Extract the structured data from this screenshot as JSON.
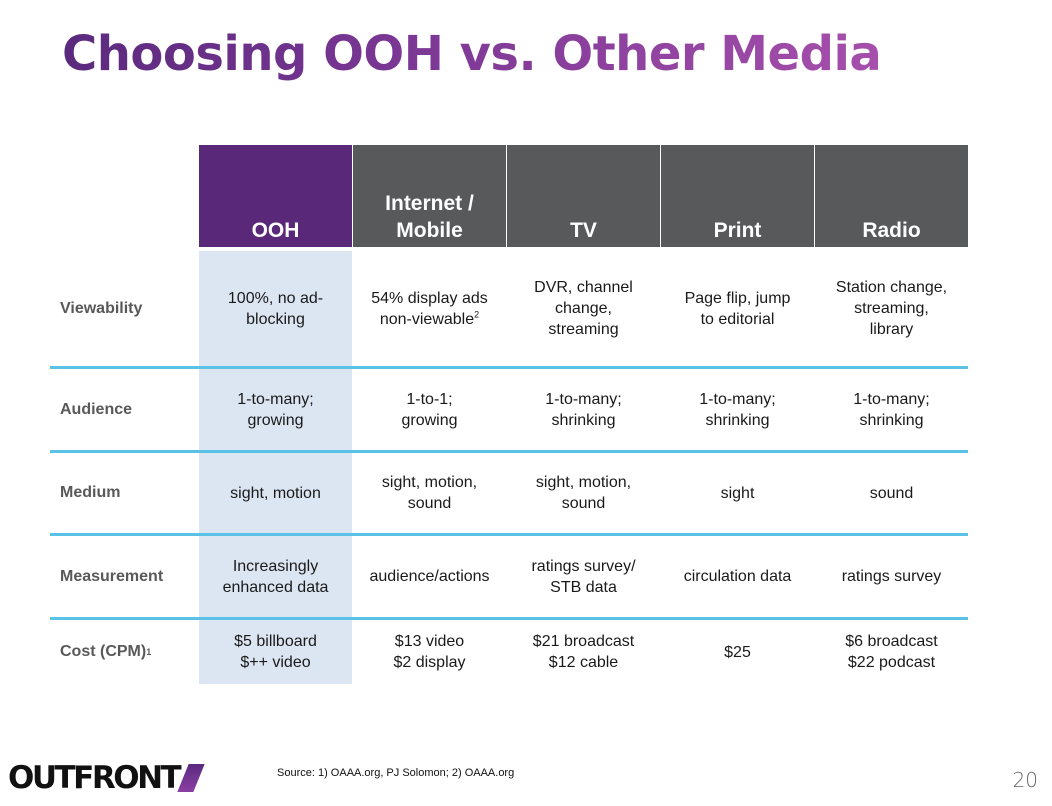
{
  "slide": {
    "title": "Choosing OOH vs. Other Media",
    "page_number": "20",
    "source": "Source: 1) OAAA.org, PJ Solomon; 2) OAAA.org",
    "logo": "OUTFRONT",
    "colors": {
      "ooh_header": "#5a2878",
      "other_header": "#58595b",
      "ooh_column_bg": "#dce6f2",
      "separator": "#5bc2e7",
      "title_start": "#5a2a7e",
      "title_end": "#a64fac"
    }
  },
  "table": {
    "headers": [
      {
        "line1": "",
        "line2": "OOH"
      },
      {
        "line1": "Internet /",
        "line2": "Mobile"
      },
      {
        "line1": "",
        "line2": "TV"
      },
      {
        "line1": "",
        "line2": "Print"
      },
      {
        "line1": "",
        "line2": "Radio"
      }
    ],
    "rows": [
      {
        "label": "Viewability",
        "label_sup": "",
        "cells": [
          {
            "lines": [
              "100%, no ad-",
              "blocking"
            ],
            "sup": ""
          },
          {
            "lines": [
              "54% display ads",
              "non-viewable"
            ],
            "sup": "2"
          },
          {
            "lines": [
              "DVR, channel",
              "change,",
              "streaming"
            ],
            "sup": ""
          },
          {
            "lines": [
              "Page flip, jump",
              "to editorial"
            ],
            "sup": ""
          },
          {
            "lines": [
              "Station change,",
              "streaming,",
              "library"
            ],
            "sup": ""
          }
        ]
      },
      {
        "label": "Audience",
        "label_sup": "",
        "cells": [
          {
            "lines": [
              "1-to-many;",
              "growing"
            ],
            "sup": ""
          },
          {
            "lines": [
              "1-to-1;",
              "growing"
            ],
            "sup": ""
          },
          {
            "lines": [
              "1-to-many;",
              "shrinking"
            ],
            "sup": ""
          },
          {
            "lines": [
              "1-to-many;",
              "shrinking"
            ],
            "sup": ""
          },
          {
            "lines": [
              "1-to-many;",
              "shrinking"
            ],
            "sup": ""
          }
        ]
      },
      {
        "label": "Medium",
        "label_sup": "",
        "cells": [
          {
            "lines": [
              "sight, motion"
            ],
            "sup": ""
          },
          {
            "lines": [
              "sight, motion,",
              "sound"
            ],
            "sup": ""
          },
          {
            "lines": [
              "sight, motion,",
              "sound"
            ],
            "sup": ""
          },
          {
            "lines": [
              "sight"
            ],
            "sup": ""
          },
          {
            "lines": [
              "sound"
            ],
            "sup": ""
          }
        ]
      },
      {
        "label": "Measurement",
        "label_sup": "",
        "cells": [
          {
            "lines": [
              "Increasingly",
              "enhanced data"
            ],
            "sup": ""
          },
          {
            "lines": [
              "audience/actions"
            ],
            "sup": ""
          },
          {
            "lines": [
              "ratings survey/",
              "STB data"
            ],
            "sup": ""
          },
          {
            "lines": [
              "circulation data"
            ],
            "sup": ""
          },
          {
            "lines": [
              "ratings survey"
            ],
            "sup": ""
          }
        ]
      },
      {
        "label": "Cost (CPM)",
        "label_sup": "1",
        "cells": [
          {
            "lines": [
              "$5 billboard",
              "$++ video"
            ],
            "sup": ""
          },
          {
            "lines": [
              "$13 video",
              "$2 display"
            ],
            "sup": ""
          },
          {
            "lines": [
              "$21 broadcast",
              "$12 cable"
            ],
            "sup": ""
          },
          {
            "lines": [
              "$25"
            ],
            "sup": ""
          },
          {
            "lines": [
              "$6 broadcast",
              "$22 podcast"
            ],
            "sup": ""
          }
        ]
      }
    ]
  }
}
